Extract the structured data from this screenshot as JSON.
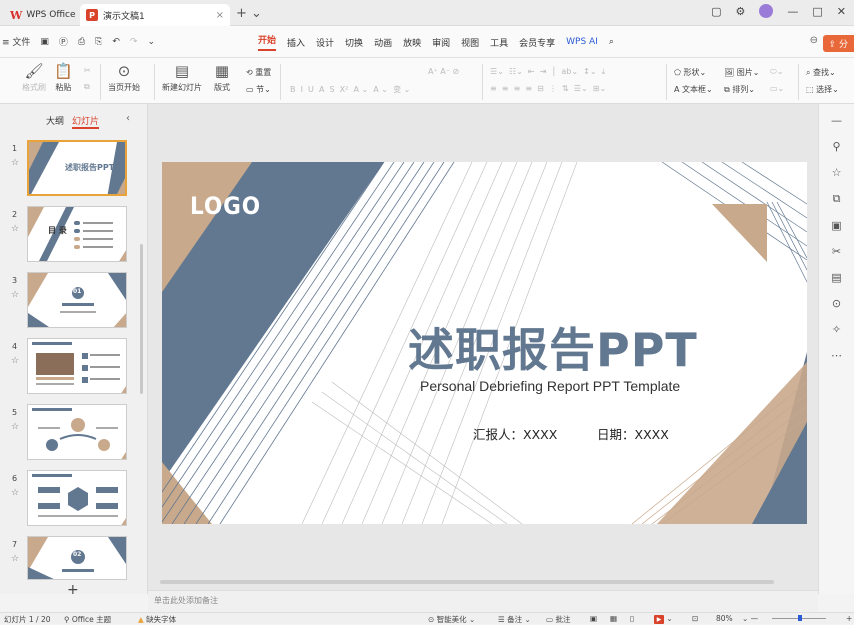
{
  "titlebar": {
    "app_name": "WPS Office",
    "doc_tab": "演示文稿1",
    "close_tab": "×",
    "new_tab": "+ ⌄"
  },
  "menubar": {
    "file": "≡ 文件",
    "tabs": [
      "开始",
      "插入",
      "设计",
      "切换",
      "动画",
      "放映",
      "审阅",
      "视图",
      "工具",
      "会员专享",
      "WPS AI"
    ],
    "share": "分"
  },
  "ribbon": {
    "format_painter": "格式刷",
    "paste": "粘贴",
    "from_start": "当页开始",
    "new_slide": "新建幻灯片",
    "layout": "版式",
    "section": "节",
    "reset": "重置",
    "shape": "形状",
    "picture": "图片",
    "textbox": "文本框",
    "arrange": "排列",
    "find": "查找",
    "select": "选择"
  },
  "panel": {
    "tab_outline": "大纲",
    "tab_slides": "幻灯片",
    "slide_numbers": [
      "1",
      "2",
      "3",
      "4",
      "5",
      "6",
      "7"
    ],
    "thumb1_title": "述职报告PPT",
    "thumb2_title": "目 录",
    "thumb3_number": "01",
    "thumb7_number": "02"
  },
  "slide": {
    "logo": "LOGO",
    "title": "述职报告PPT",
    "subtitle": "Personal Debriefing Report PPT Template",
    "reporter": "汇报人：XXXX",
    "date": "日期：XXXX"
  },
  "notes_placeholder": "单击此处添加备注",
  "status": {
    "slide_count": "幻灯片 1 / 20",
    "theme": "Office 主题",
    "missing_font": "缺失字体",
    "beautify": "智能美化",
    "notes": "备注",
    "comments": "批注",
    "zoom": "80%"
  },
  "colors": {
    "slate": "#627890",
    "tan": "#c9a98c",
    "accent": "#d9432c"
  }
}
